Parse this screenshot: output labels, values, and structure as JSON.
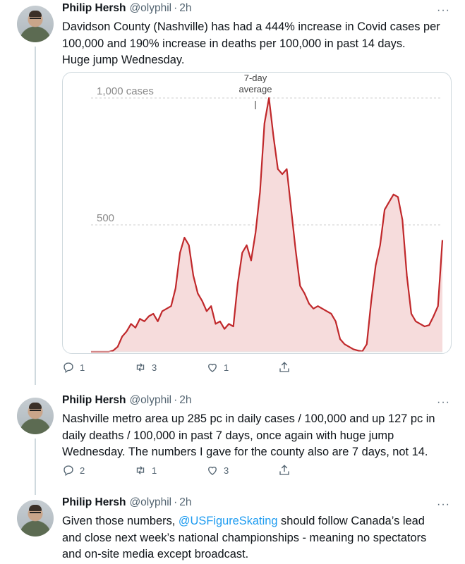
{
  "tweets": [
    {
      "name": "Philip Hersh",
      "handle": "@olyphil",
      "time": "2h",
      "text_lines": [
        "Davidson County (Nashville) has had a 444% increase in Covid cases per",
        "100,000 and 190% increase in deaths per 100,000 in past 14 days.",
        "Huge jump Wednesday."
      ],
      "replies": "1",
      "retweets": "3",
      "likes": "1"
    },
    {
      "name": "Philip Hersh",
      "handle": "@olyphil",
      "time": "2h",
      "text_lines": [
        "Nashville metro area up 285 pc in daily cases / 100,000 and up 127 pc in",
        "daily deaths /  100,000 in past 7  days, once again with huge jump",
        "Wednesday.  The numbers I gave for the county also are 7 days, not 14."
      ],
      "replies": "2",
      "retweets": "1",
      "likes": "3"
    },
    {
      "name": "Philip Hersh",
      "handle": "@olyphil",
      "time": "2h",
      "text_parts": {
        "line1_pre": "Given those numbers, ",
        "mention": "@USFigureSkating",
        "line1_post": " should follow Canada’s lead"
      },
      "text_lines": [
        "and close next week’s national championships - meaning no spectators",
        "and on-site media except broadcast."
      ]
    }
  ],
  "chart_data": {
    "type": "area",
    "annotation": "7-day average",
    "gridlines": [
      {
        "value": 1000,
        "label": "1,000 cases"
      },
      {
        "value": 500,
        "label": "500"
      }
    ],
    "ylim": [
      0,
      1100
    ],
    "colors": {
      "line": "#c0282b",
      "fill": "#f6dcdc",
      "grid": "#cfcfcf",
      "label": "#8a8a8a"
    },
    "values": [
      0,
      0,
      0,
      0,
      0,
      5,
      20,
      60,
      80,
      110,
      95,
      130,
      120,
      140,
      150,
      120,
      160,
      170,
      180,
      250,
      390,
      450,
      420,
      300,
      230,
      200,
      160,
      180,
      110,
      120,
      90,
      110,
      100,
      270,
      390,
      420,
      360,
      470,
      630,
      900,
      1000,
      850,
      720,
      700,
      720,
      560,
      400,
      260,
      230,
      190,
      170,
      180,
      170,
      160,
      150,
      120,
      50,
      30,
      20,
      10,
      5,
      2,
      30,
      200,
      340,
      420,
      560,
      590,
      620,
      610,
      520,
      300,
      150,
      120,
      110,
      100,
      105,
      140,
      180,
      440
    ]
  },
  "icons": {
    "reply": "reply-icon",
    "retweet": "retweet-icon",
    "like": "heart-icon",
    "share": "share-icon",
    "more": "more-icon"
  }
}
